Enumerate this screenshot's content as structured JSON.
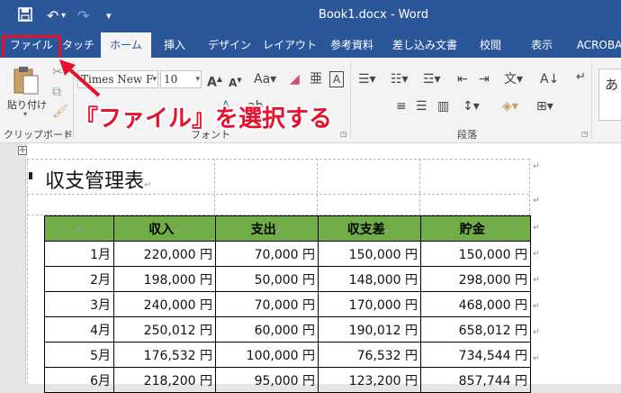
{
  "window": {
    "title": "Book1.docx  -  Word"
  },
  "qat": {
    "save_icon": "save-icon",
    "undo_icon": "undo-icon",
    "redo_icon": "redo-icon",
    "customize_icon": "customize-qat-icon"
  },
  "tabs": [
    {
      "label": "ファイル",
      "active": false
    },
    {
      "label": "タッチ",
      "active": false
    },
    {
      "label": "ホーム",
      "active": true
    },
    {
      "label": "挿入",
      "active": false
    },
    {
      "label": "デザイン",
      "active": false
    },
    {
      "label": "レイアウト",
      "active": false
    },
    {
      "label": "参考資料",
      "active": false
    },
    {
      "label": "差し込み文書",
      "active": false
    },
    {
      "label": "校閲",
      "active": false
    },
    {
      "label": "表示",
      "active": false
    },
    {
      "label": "ACROBA",
      "active": false
    }
  ],
  "ribbon": {
    "paste_label": "貼り付け",
    "clipboard_label": "クリップボード",
    "font_label": "フォント",
    "paragraph_label": "段落",
    "font_name": "Times New F",
    "font_size": "10",
    "style_preview": "あ"
  },
  "callout": {
    "text": "『ファイル』を選択する",
    "color": "#e8112d"
  },
  "document": {
    "title": "収支管理表",
    "table": {
      "header_color": "#70ad47",
      "columns": [
        "",
        "収入",
        "支出",
        "収支差",
        "貯金"
      ],
      "rows": [
        [
          "1月",
          "220,000 円",
          "70,000 円",
          "150,000 円",
          "150,000 円"
        ],
        [
          "2月",
          "198,000 円",
          "50,000 円",
          "148,000 円",
          "298,000 円"
        ],
        [
          "3月",
          "240,000 円",
          "70,000 円",
          "170,000 円",
          "468,000 円"
        ],
        [
          "4月",
          "250,012 円",
          "60,000 円",
          "190,012 円",
          "658,012 円"
        ],
        [
          "5月",
          "176,532 円",
          "100,000 円",
          "76,532 円",
          "734,544 円"
        ],
        [
          "6月",
          "218,200 円",
          "95,000 円",
          "123,200 円",
          "857,744 円"
        ]
      ]
    }
  },
  "colors": {
    "titlebar": "#2b579a",
    "highlight": "#e8112d"
  }
}
